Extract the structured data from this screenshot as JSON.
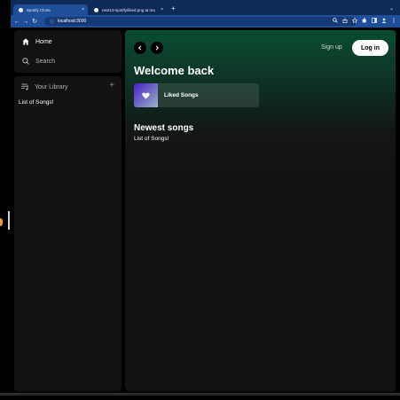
{
  "browser": {
    "tabs": [
      {
        "title": "Spotify Clone",
        "active": true,
        "favicon_color": "#ffffff"
      },
      {
        "title": "next13-spotify/liked.png at ma",
        "active": false,
        "favicon_color": "#ffffff"
      }
    ],
    "url": "localhost:3000",
    "close_glyph": "×",
    "new_tab_glyph": "+",
    "back_glyph": "←",
    "forward_glyph": "→",
    "reload_glyph": "↻",
    "menu_chevron": "⌄",
    "info_icon": "ⓘ",
    "toolbar_icons": [
      "zoom-icon",
      "share-icon",
      "star-icon",
      "extensions-icon",
      "sidepanel-icon",
      "profile-icon",
      "menu-icon"
    ]
  },
  "sidebar": {
    "home_label": "Home",
    "search_label": "Search",
    "library_label": "Your Library",
    "add_glyph": "+",
    "library_text": "List of Songs!"
  },
  "header": {
    "signup_label": "Sign up",
    "login_label": "Log in"
  },
  "main": {
    "greeting": "Welcome back",
    "liked_label": "Liked Songs",
    "newest_title": "Newest songs",
    "newest_text": "List of Songs!"
  },
  "colors": {
    "accent_gradient_top": "#0a4d32",
    "panel": "#121212",
    "browser_tab": "#1f4f9a"
  }
}
